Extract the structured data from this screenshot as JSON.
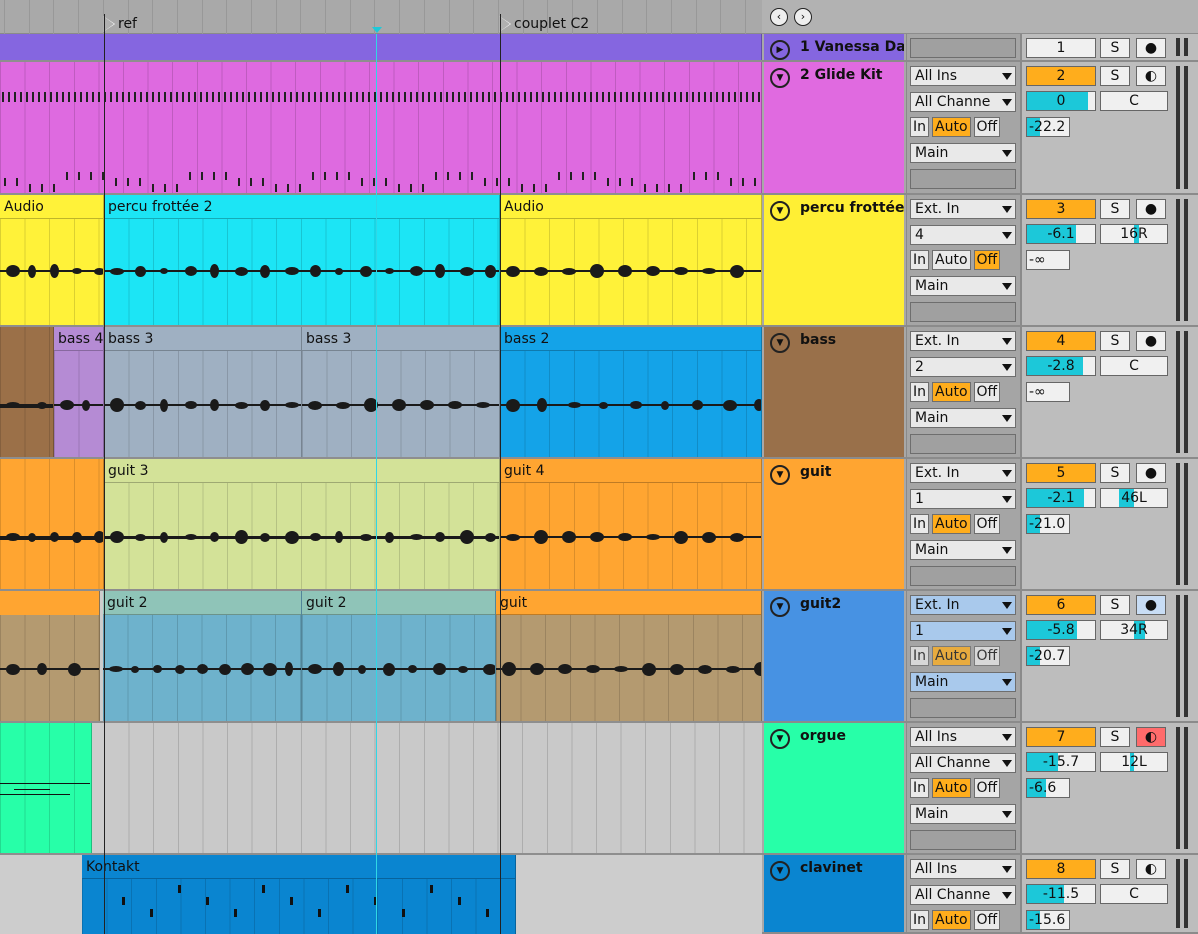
{
  "locators": [
    {
      "label": "ref"
    },
    {
      "label": "couplet C2"
    }
  ],
  "clips": {
    "track1": [],
    "track3": [
      {
        "label": "Audio"
      },
      {
        "label": "percu frottée 2"
      },
      {
        "label": "Audio"
      }
    ],
    "track4": [
      {
        "label": "bass 4"
      },
      {
        "label": "bass 3"
      },
      {
        "label": "bass 3"
      },
      {
        "label": "bass 2"
      }
    ],
    "track5": [
      {
        "label": "guit 3"
      },
      {
        "label": "guit 4"
      }
    ],
    "track6": [
      {
        "label": "guit 2"
      },
      {
        "label": "guit 2"
      },
      {
        "label": "guit"
      }
    ],
    "track8": [
      {
        "label": "Kontakt"
      }
    ]
  },
  "tracks": [
    {
      "name": "1 Vanessa Da",
      "color": "#8566e0",
      "number": "1",
      "solo": "S",
      "arm": "●",
      "number_active": false
    },
    {
      "name": "2 Glide Kit",
      "color": "#e06ae0",
      "input": "All Ins",
      "channel": "All Channe",
      "mon_in": "In",
      "mon_auto": "Auto",
      "mon_off": "Off",
      "output": "Main",
      "number": "2",
      "solo": "S",
      "arm": "◐",
      "volume": "0",
      "volume_level": 0.9,
      "pan": "C",
      "send": "-22.2",
      "send_level": 0.3
    },
    {
      "name": "percu frottée",
      "color": "#ffef34",
      "input": "Ext. In",
      "channel": "4",
      "mon_in": "In",
      "mon_auto": "Auto",
      "mon_off": "Off",
      "output": "Main",
      "number": "3",
      "solo": "S",
      "arm": "●",
      "volume": "-6.1",
      "volume_level": 0.72,
      "pan": "16R",
      "pan_level": 0.16,
      "send": "-∞",
      "send_level": 0
    },
    {
      "name": "bass",
      "color": "#99704a",
      "input": "Ext. In",
      "channel": "2",
      "mon_in": "In",
      "mon_auto": "Auto",
      "mon_off": "Off",
      "output": "Main",
      "number": "4",
      "solo": "S",
      "arm": "●",
      "volume": "-2.8",
      "volume_level": 0.82,
      "pan": "C",
      "send": "-∞",
      "send_level": 0
    },
    {
      "name": "guit",
      "color": "#ffa531",
      "input": "Ext. In",
      "channel": "1",
      "mon_in": "In",
      "mon_auto": "Auto",
      "mon_off": "Off",
      "output": "Main",
      "number": "5",
      "solo": "S",
      "arm": "●",
      "volume": "-2.1",
      "volume_level": 0.84,
      "pan": "46L",
      "pan_level": 0.46,
      "send": "-21.0",
      "send_level": 0.3
    },
    {
      "name": "guit2",
      "color": "#4792e3",
      "input": "Ext. In",
      "channel": "1",
      "mon_in": "In",
      "mon_auto": "Auto",
      "mon_off": "Off",
      "output": "Main",
      "number": "6",
      "solo": "S",
      "arm": "●",
      "volume": "-5.8",
      "volume_level": 0.73,
      "pan": "34R",
      "pan_level": 0.34,
      "send": "-20.7",
      "send_level": 0.3
    },
    {
      "name": "orgue",
      "color": "#27ffa8",
      "input": "All Ins",
      "channel": "All Channe",
      "mon_in": "In",
      "mon_auto": "Auto",
      "mon_off": "Off",
      "output": "Main",
      "number": "7",
      "solo": "S",
      "arm": "◐",
      "volume": "-15.7",
      "volume_level": 0.45,
      "pan": "12L",
      "pan_level": 0.12,
      "send": "-6.6",
      "send_level": 0.45
    },
    {
      "name": "clavinet",
      "color": "#0a85d0",
      "input": "All Ins",
      "channel": "All Channe",
      "mon_in": "In",
      "mon_auto": "Auto",
      "mon_off": "Off",
      "number": "8",
      "solo": "S",
      "arm": "◐",
      "volume": "-11.5",
      "volume_level": 0.55,
      "pan": "C",
      "send": "-15.6",
      "send_level": 0.3
    }
  ]
}
